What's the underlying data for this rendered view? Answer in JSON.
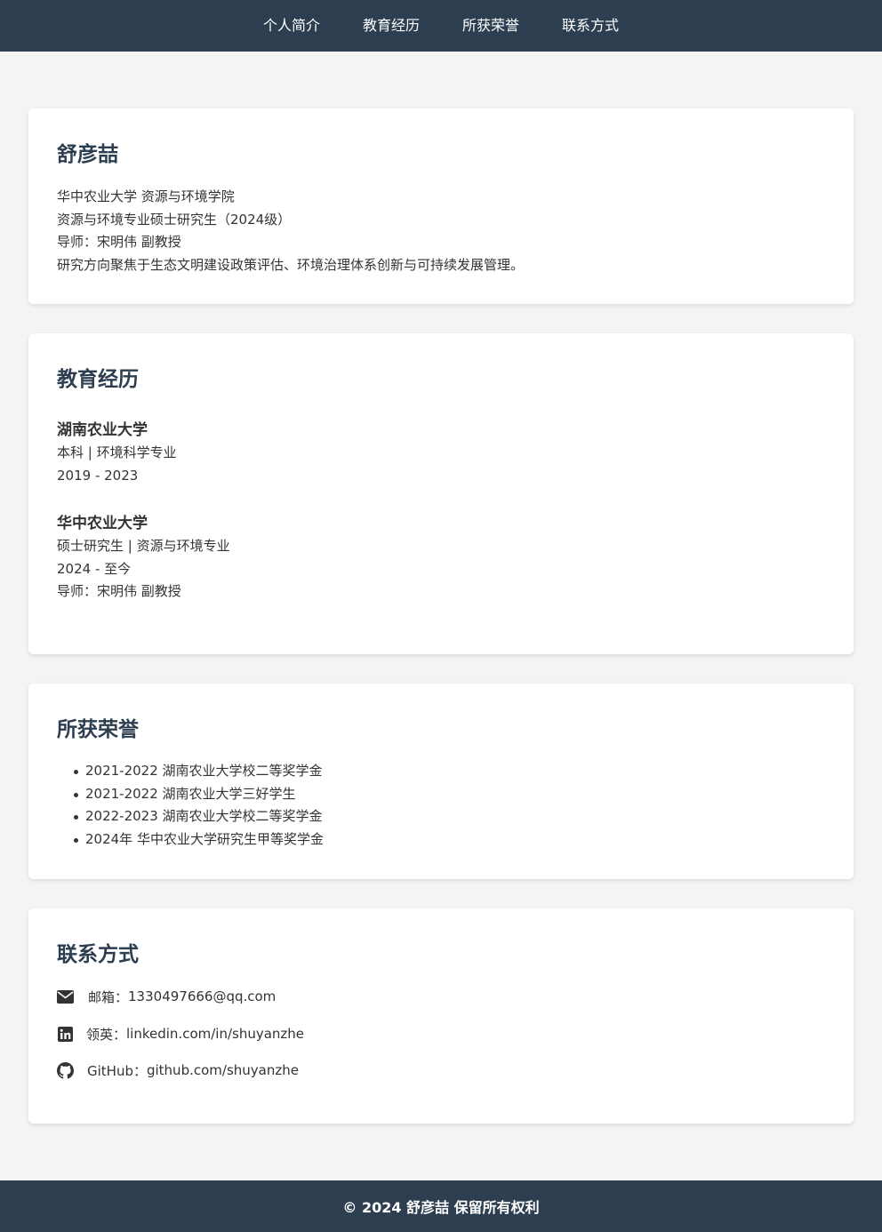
{
  "nav": {
    "items": [
      "个人简介",
      "教育经历",
      "所获荣誉",
      "联系方式"
    ]
  },
  "profile": {
    "name": "舒彦喆",
    "lines": [
      "华中农业大学 资源与环境学院",
      "资源与环境专业硕士研究生（2024级）",
      "导师：宋明伟 副教授",
      "研究方向聚焦于生态文明建设政策评估、环境治理体系创新与可持续发展管理。"
    ]
  },
  "education": {
    "title": "教育经历",
    "entries": [
      {
        "school": "湖南农业大学",
        "degree": "本科 | 环境科学专业",
        "period": "2019 - 2023"
      },
      {
        "school": "华中农业大学",
        "degree": "硕士研究生 | 资源与环境专业",
        "period": "2024 - 至今",
        "advisor": "导师：宋明伟 副教授"
      }
    ]
  },
  "honors": {
    "title": "所获荣誉",
    "items": [
      "2021-2022 湖南农业大学校二等奖学金",
      "2021-2022 湖南农业大学三好学生",
      "2022-2023 湖南农业大学校二等奖学金",
      "2024年 华中农业大学研究生甲等奖学金"
    ]
  },
  "contact": {
    "title": "联系方式",
    "email": {
      "icon": "envelope-icon",
      "label": "邮箱：",
      "value": "1330497666@qq.com"
    },
    "linkedin": {
      "icon": "linkedin-icon",
      "label": "领英：",
      "value": "linkedin.com/in/shuyanzhe"
    },
    "github": {
      "icon": "github-icon",
      "label": "GitHub：",
      "value": "github.com/shuyanzhe"
    }
  },
  "footer": {
    "text": "© 2024 舒彦喆 保留所有权利"
  },
  "colors": {
    "header_bg": "#2c3e50",
    "page_bg": "#f4f4f4",
    "card_bg": "#ffffff",
    "heading": "#2c3e50"
  }
}
